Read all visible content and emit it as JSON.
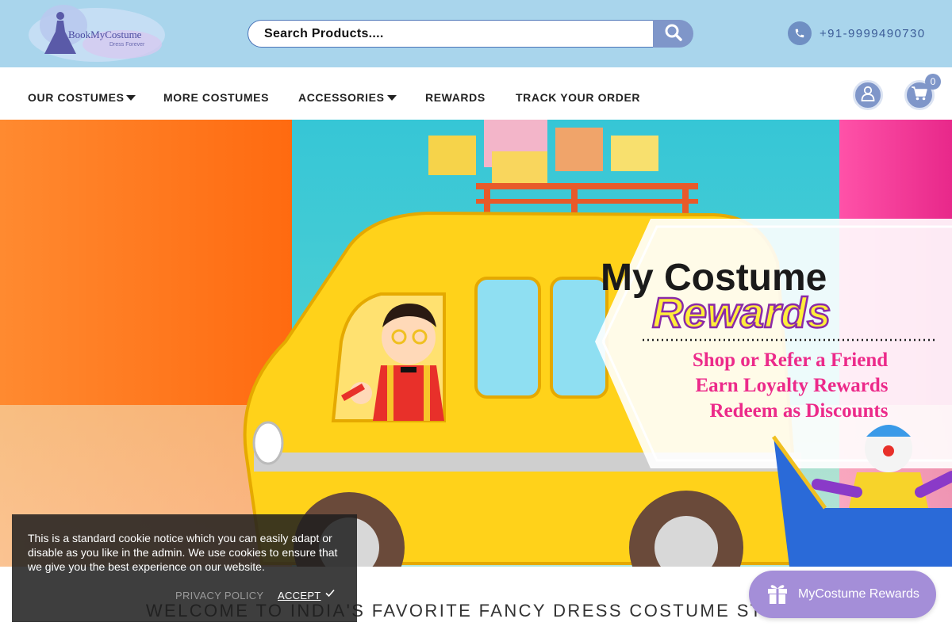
{
  "header": {
    "logo_text": "BookMyCostume",
    "logo_tagline": "Dress Forever",
    "search": {
      "placeholder": "Search Products...."
    },
    "phone": "+91-9999490730"
  },
  "nav": {
    "items": [
      {
        "label": "OUR COSTUMES",
        "has_dropdown": true
      },
      {
        "label": "MORE COSTUMES",
        "has_dropdown": false
      },
      {
        "label": "ACCESSORIES",
        "has_dropdown": true
      },
      {
        "label": "REWARDS",
        "has_dropdown": false
      },
      {
        "label": "TRACK YOUR ORDER",
        "has_dropdown": false
      }
    ],
    "cart_count": "0"
  },
  "hero": {
    "title_line1": "My Costume",
    "title_line2": "Rewards",
    "bullets": [
      "Shop or Refer a Friend",
      "Earn Loyalty Rewards",
      "Redeem as Discounts"
    ]
  },
  "welcome": "WELCOME TO INDIA'S FAVORITE FANCY DRESS COSTUME STORE",
  "cookie": {
    "text": "This is a standard cookie notice which you can easily adapt or disable as you like in the admin. We use cookies to ensure that we give you the best experience on our website.",
    "privacy_label": "PRIVACY POLICY",
    "accept_label": "ACCEPT"
  },
  "rewards_widget": {
    "label": "MyCostume Rewards"
  },
  "colors": {
    "header_bg": "#a9d5ec",
    "accent": "#7f96c9",
    "rewards_pill": "#a48ed8",
    "hero_orange": "#ff7a20",
    "hero_teal": "#3fcfd6",
    "hero_pink": "#f04aa0"
  },
  "icons": {
    "search": "magnifier-icon",
    "phone": "phone-icon",
    "account": "user-icon",
    "cart": "cart-icon",
    "gift": "gift-icon",
    "check": "check-icon"
  }
}
